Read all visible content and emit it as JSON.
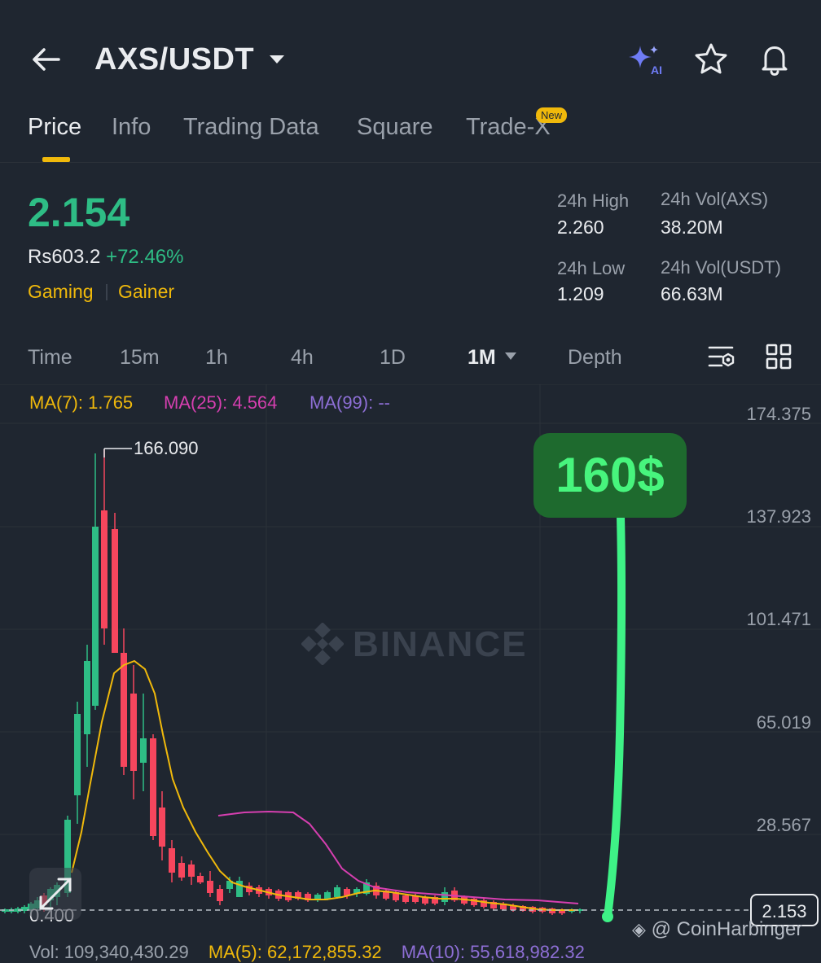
{
  "header": {
    "pair": "AXS/USDT",
    "icons": [
      "back-arrow-icon",
      "chevron-down-icon",
      "ai-sparkle-icon",
      "star-icon",
      "bell-icon"
    ]
  },
  "tabs": {
    "items": [
      "Price",
      "Info",
      "Trading Data",
      "Square",
      "Trade-X"
    ],
    "active": "Price",
    "new_badge": "New"
  },
  "price": {
    "last": "2.154",
    "fiat": "Rs603.2",
    "change": "+72.46%",
    "tags": [
      "Gaming",
      "Gainer"
    ]
  },
  "stats": {
    "high_label": "24h High",
    "high": "2.260",
    "low_label": "24h Low",
    "low": "1.209",
    "vol_base_label": "24h Vol(AXS)",
    "vol_base": "38.20M",
    "vol_quote_label": "24h Vol(USDT)",
    "vol_quote": "66.63M"
  },
  "intervals": {
    "items": [
      "Time",
      "15m",
      "1h",
      "4h",
      "1D",
      "1M",
      "Depth"
    ],
    "active": "1M"
  },
  "ma": {
    "ma7": "MA(7): 1.765",
    "ma25": "MA(25): 4.564",
    "ma99": "MA(99): --"
  },
  "chart": {
    "y_ticks": [
      "174.375",
      "137.923",
      "101.471",
      "65.019",
      "28.567"
    ],
    "peak_label": "166.090",
    "low_label": "0.400",
    "current_price": "2.153",
    "watermark": "BINANCE",
    "annotation": "160$",
    "credit": "@ CoinHarbinger"
  },
  "volume": {
    "vol": "Vol: 109,340,430.29",
    "ma5": "MA(5): 62,172,855.32",
    "ma10": "MA(10): 55,618,982.32"
  },
  "colors": {
    "bg": "#1f2630",
    "up": "#2ebd85",
    "down": "#f6465d",
    "accent": "#f0b90b",
    "ma7": "#f0b90b",
    "ma25": "#d63fb0",
    "ma99": "#8e6fd6",
    "annotation": "#47f57d"
  }
}
